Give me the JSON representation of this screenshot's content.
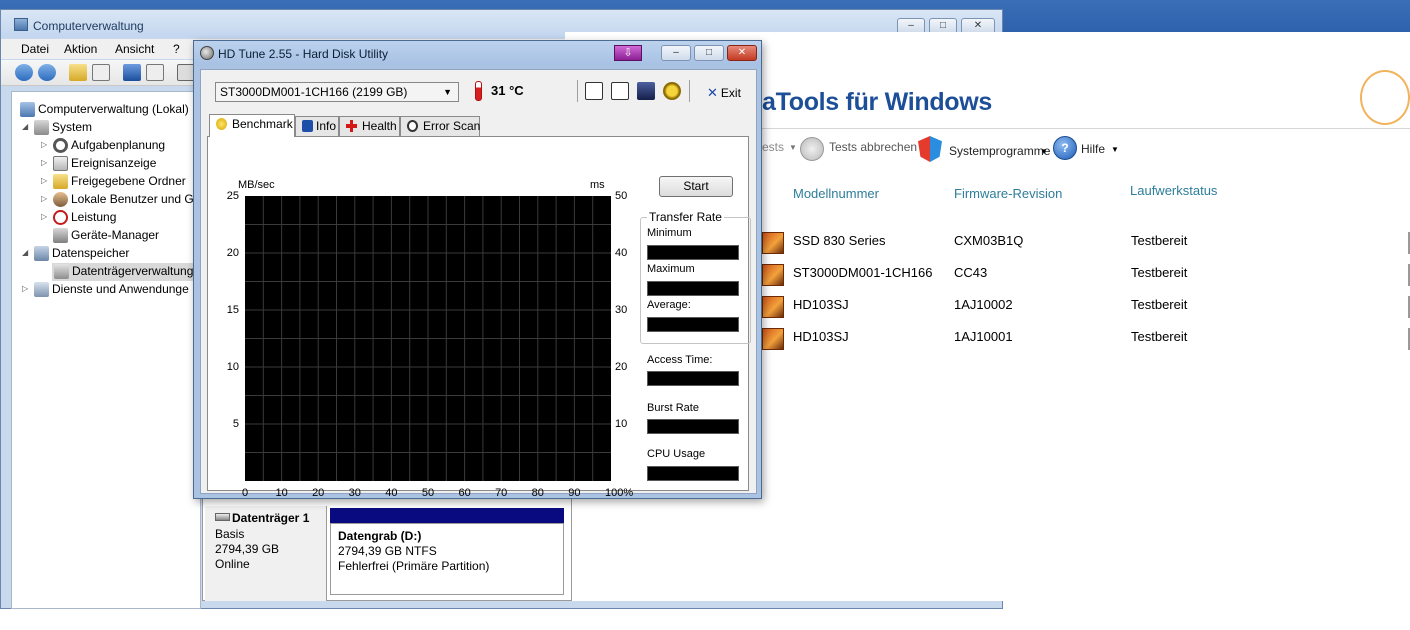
{
  "cv_window": {
    "title": "Computerverwaltung",
    "caption_buttons": {
      "minimize": "‒",
      "maximize": "□",
      "close": "✕"
    },
    "menu": [
      "Datei",
      "Aktion",
      "Ansicht",
      "?"
    ],
    "tree": [
      {
        "label": "Computerverwaltung (Lokal)",
        "icon": "computer-icon",
        "level": 0,
        "expander": ""
      },
      {
        "label": "System",
        "icon": "tools-icon",
        "level": 1,
        "expander": "◢"
      },
      {
        "label": "Aufgabenplanung",
        "icon": "clock-icon",
        "level": 2,
        "expander": "▷"
      },
      {
        "label": "Ereignisanzeige",
        "icon": "event-viewer-icon",
        "level": 2,
        "expander": "▷"
      },
      {
        "label": "Freigegebene Ordner",
        "icon": "shared-folder-icon",
        "level": 2,
        "expander": "▷"
      },
      {
        "label": "Lokale Benutzer und G",
        "icon": "users-icon",
        "level": 2,
        "expander": "▷"
      },
      {
        "label": "Leistung",
        "icon": "performance-icon",
        "level": 2,
        "expander": "▷"
      },
      {
        "label": "Geräte-Manager",
        "icon": "device-manager-icon",
        "level": 2,
        "expander": ""
      },
      {
        "label": "Datenspeicher",
        "icon": "storage-icon",
        "level": 1,
        "expander": "◢"
      },
      {
        "label": "Datenträgerverwaltung",
        "icon": "disk-management-icon",
        "level": 2,
        "expander": ""
      },
      {
        "label": "Dienste und Anwendunge",
        "icon": "services-icon",
        "level": 1,
        "expander": "▷"
      }
    ],
    "disk": {
      "name": "Datenträger 1",
      "type": "Basis",
      "size": "2794,39 GB",
      "status": "Online",
      "partition_name": "Datengrab  (D:)",
      "partition_size": "2794,39 GB NTFS",
      "partition_status": "Fehlerfrei (Primäre Partition)"
    }
  },
  "datatools": {
    "heading": "aTools für Windows",
    "toolbar": {
      "tests_partial": "ests",
      "cancel_tests": "Tests abbrechen",
      "system_programs": "Systemprogramme",
      "help": "Hilfe"
    },
    "columns": [
      "Modellnummer",
      "Firmware-Revision",
      "Laufwerkstatus"
    ],
    "rows": [
      {
        "model": "SSD 830 Series",
        "firmware": "CXM03B1Q",
        "status": "Testbereit"
      },
      {
        "model": "ST3000DM001-1CH166",
        "firmware": "CC43",
        "status": "Testbereit"
      },
      {
        "model": "HD103SJ",
        "firmware": "1AJ10002",
        "status": "Testbereit"
      },
      {
        "model": "HD103SJ",
        "firmware": "1AJ10001",
        "status": "Testbereit"
      }
    ]
  },
  "hdtune": {
    "title": "HD Tune 2.55 - Hard Disk Utility",
    "drive": "ST3000DM001-1CH166 (2199 GB)",
    "temperature": "31 °C",
    "exit_label": "Exit",
    "tabs": [
      "Benchmark",
      "Info",
      "Health",
      "Error Scan"
    ],
    "active_tab": "Benchmark",
    "start_button": "Start",
    "y_left_unit": "MB/sec",
    "y_right_unit": "ms",
    "y_left_ticks": [
      "25",
      "20",
      "15",
      "10",
      "5"
    ],
    "y_right_ticks": [
      "50",
      "40",
      "30",
      "20",
      "10"
    ],
    "x_ticks": [
      "0",
      "10",
      "20",
      "30",
      "40",
      "50",
      "60",
      "70",
      "80",
      "90",
      "100%"
    ],
    "transfer_rate_label": "Transfer Rate",
    "stats": [
      "Minimum",
      "Maximum",
      "Average:",
      "Access Time:",
      "Burst Rate",
      "CPU Usage"
    ],
    "stat_values": [
      "",
      "",
      "",
      "",
      "",
      ""
    ]
  },
  "colors": {
    "plot_background": "#000000",
    "grid": "#3a3a3a",
    "disk_bar": "#0a0a80",
    "datatools_heading": "#1c4f97",
    "datatools_column": "#2e7d9a"
  }
}
